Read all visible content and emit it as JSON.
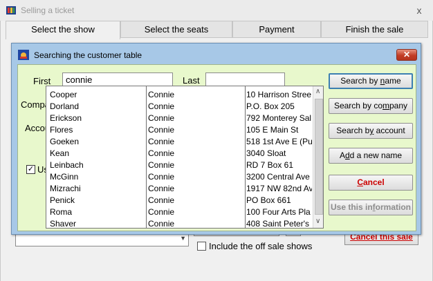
{
  "outer_window": {
    "title": "Selling a ticket",
    "close_symbol": "x",
    "tabs": [
      "Select the show",
      "Select the seats",
      "Payment",
      "Finish the sale"
    ],
    "active_tab": "Select the show",
    "include_off_sale_label": "Include the off sale shows",
    "cancel_sale_label": "Cancel this sale"
  },
  "dialog": {
    "title": "Searching the customer table",
    "close_symbol": "✕",
    "first_label": "First",
    "first_value": "connie",
    "last_label": "Last",
    "last_value": "",
    "partial_labels": {
      "company": "Compa",
      "account": "Accou",
      "use_checkbox": "Us"
    },
    "buttons": {
      "search_by_name": {
        "pre": "Search by ",
        "ul": "n",
        "post": "ame"
      },
      "search_by_company": {
        "pre": "Search by co",
        "ul": "m",
        "post": "pany"
      },
      "search_by_account": {
        "pre": "Search b",
        "ul": "y",
        "post": " account"
      },
      "add_new_name": {
        "pre": "A",
        "ul": "d",
        "post": "d a new name"
      },
      "cancel": {
        "pre": "",
        "ul": "C",
        "post": "ancel"
      },
      "use_this_information": {
        "pre": "Use this in",
        "ul": "f",
        "post": "ormation"
      }
    }
  },
  "results": [
    {
      "last": "Cooper",
      "first": "Connie",
      "address": "10 Harrison Stree"
    },
    {
      "last": "Dorland",
      "first": "Connie",
      "address": "P.O. Box 205"
    },
    {
      "last": "Erickson",
      "first": "Connie",
      "address": "792 Monterey Sal"
    },
    {
      "last": "Flores",
      "first": "Connie",
      "address": "105 E Main St"
    },
    {
      "last": "Goeken",
      "first": "Connie",
      "address": "518 1st Ave E  (Pu"
    },
    {
      "last": "Kean",
      "first": "Connie",
      "address": "3040 Sloat"
    },
    {
      "last": "Leinbach",
      "first": "Connie",
      "address": "RD 7 Box 61"
    },
    {
      "last": "McGinn",
      "first": "Connie",
      "address": "3200 Central Ave"
    },
    {
      "last": "Mizrachi",
      "first": "Connie",
      "address": "1917 NW 82nd Av"
    },
    {
      "last": "Penick",
      "first": "Connie",
      "address": "PO Box 661"
    },
    {
      "last": "Roma",
      "first": "Connie",
      "address": "100 Four Arts Pla"
    },
    {
      "last": "Shaver",
      "first": "Connie",
      "address": "408 Saint Peter's"
    }
  ],
  "colors": {
    "dialog_frame": "#a7c8e7",
    "dialog_client": "#e8f8cc",
    "cancel_text": "#cc0000",
    "close_button": "#c23d26"
  }
}
